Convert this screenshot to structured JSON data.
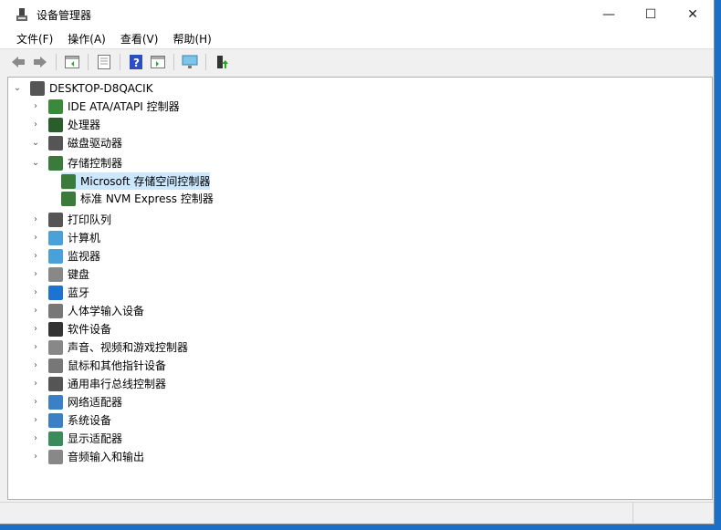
{
  "window": {
    "title": "设备管理器",
    "minimize": "—",
    "maximize": "☐",
    "close": "✕"
  },
  "menu": [
    "文件(F)",
    "操作(A)",
    "查看(V)",
    "帮助(H)"
  ],
  "toolbar": [
    "back",
    "forward",
    "show-hide-console-tree",
    "properties",
    "help",
    "action-pane",
    "scan-hardware",
    "update-driver"
  ],
  "tree": {
    "root": "DESKTOP-D8QACIK",
    "items": [
      {
        "label": "IDE ATA/ATAPI 控制器",
        "expanded": false
      },
      {
        "label": "处理器",
        "expanded": false
      },
      {
        "label": "磁盘驱动器",
        "expanded": true
      },
      {
        "label": "存储控制器",
        "expanded": true,
        "children": [
          "Microsoft 存储空间控制器",
          "标准 NVM Express 控制器"
        ]
      },
      {
        "label": "打印队列",
        "expanded": false
      },
      {
        "label": "计算机",
        "expanded": false
      },
      {
        "label": "监视器",
        "expanded": false
      },
      {
        "label": "键盘",
        "expanded": false
      },
      {
        "label": "蓝牙",
        "expanded": false
      },
      {
        "label": "人体学输入设备",
        "expanded": false
      },
      {
        "label": "软件设备",
        "expanded": false
      },
      {
        "label": "声音、视频和游戏控制器",
        "expanded": false
      },
      {
        "label": "鼠标和其他指针设备",
        "expanded": false
      },
      {
        "label": "通用串行总线控制器",
        "expanded": false
      },
      {
        "label": "网络适配器",
        "expanded": false
      },
      {
        "label": "系统设备",
        "expanded": false
      },
      {
        "label": "显示适配器",
        "expanded": false
      },
      {
        "label": "音频输入和输出",
        "expanded": false
      }
    ],
    "selected": "Microsoft 存储空间控制器"
  },
  "colors": {
    "selection": "#cce8ff",
    "desktop": "#1a6fc9"
  }
}
